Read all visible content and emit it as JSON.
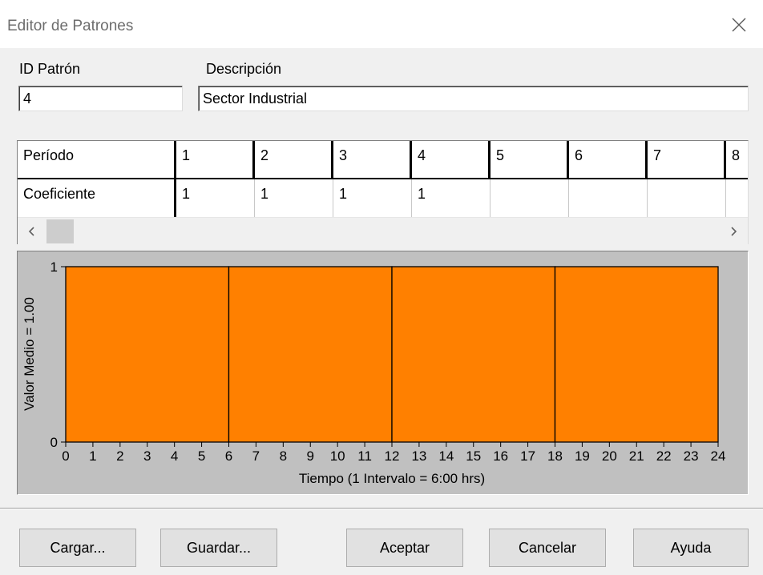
{
  "window": {
    "title": "Editor de Patrones",
    "close_icon": "close-icon"
  },
  "fields": {
    "id_label": "ID Patrón",
    "id_value": "4",
    "desc_label": "Descripción",
    "desc_value": "Sector Industrial"
  },
  "grid": {
    "row_headers": [
      "Período",
      "Coeficiente"
    ],
    "periods": [
      "1",
      "2",
      "3",
      "4",
      "5",
      "6",
      "7",
      "8"
    ],
    "coefficients": [
      "1",
      "1",
      "1",
      "1",
      "",
      "",
      "",
      ""
    ],
    "scroll_left_icon": "chevron-left-icon",
    "scroll_right_icon": "chevron-right-icon"
  },
  "chart_data": {
    "type": "bar",
    "bins": [
      [
        0,
        6
      ],
      [
        6,
        12
      ],
      [
        12,
        18
      ],
      [
        18,
        24
      ]
    ],
    "values": [
      1,
      1,
      1,
      1
    ],
    "bar_color": "#ff8000",
    "background_color": "#c0c0c0",
    "xlabel": "Tiempo (1 Intervalo = 6:00 hrs)",
    "ylabel": "Valor Medio = 1.00",
    "xlim": [
      0,
      24
    ],
    "ylim": [
      0,
      1
    ],
    "x_ticks": [
      "0",
      "1",
      "2",
      "3",
      "4",
      "5",
      "6",
      "7",
      "8",
      "9",
      "10",
      "11",
      "12",
      "13",
      "14",
      "15",
      "16",
      "17",
      "18",
      "19",
      "20",
      "21",
      "22",
      "23",
      "24"
    ],
    "y_ticks": [
      "0",
      "1"
    ],
    "grid": false
  },
  "buttons": {
    "load": "Cargar...",
    "save": "Guardar...",
    "accept": "Aceptar",
    "cancel": "Cancelar",
    "help": "Ayuda"
  }
}
